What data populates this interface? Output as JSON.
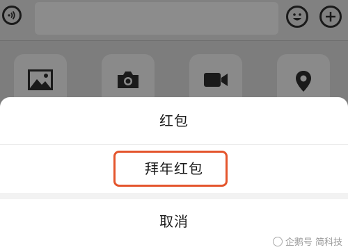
{
  "input_bar": {
    "voice_icon": "voice-wave-icon",
    "emoji_icon": "smiley-icon",
    "plus_icon": "plus-icon"
  },
  "tools": [
    {
      "icon": "image-icon"
    },
    {
      "icon": "camera-icon"
    },
    {
      "icon": "video-camera-icon"
    },
    {
      "icon": "location-pin-icon"
    }
  ],
  "action_sheet": {
    "item_red_packet": "红包",
    "item_new_year_red_packet": "拜年红包",
    "cancel": "取消"
  },
  "watermark": {
    "text": "企鹅号 简科技"
  },
  "colors": {
    "overlay": "#7d7d7d",
    "highlight_border": "#e4552c",
    "sheet_bg": "#ffffff"
  }
}
